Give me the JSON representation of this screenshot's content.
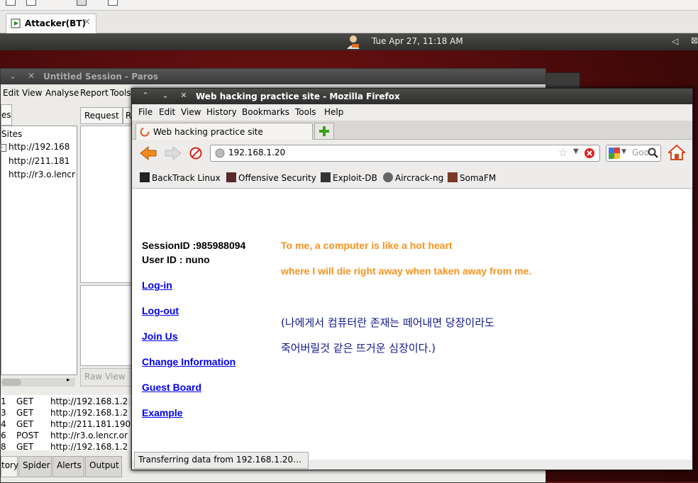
{
  "vm": {
    "tab_label": "Attacker(BT)"
  },
  "panel": {
    "clock": "Tue Apr 27, 11:18 AM"
  },
  "paros": {
    "title": "Untitled Session - Paros",
    "menu": [
      "Edit",
      "View",
      "Analyse",
      "Report",
      "Tools"
    ],
    "sites_tab": "es",
    "sites_root": "Sites",
    "sites": [
      "http://192.168",
      "http://211.181",
      "http://r3.o.lencr"
    ],
    "request_tab": "Request",
    "request_tab2": "R",
    "raw_view": "Raw View",
    "history": [
      {
        "id": "1",
        "method": "GET",
        "url": "http://192.168.1.2"
      },
      {
        "id": "3",
        "method": "GET",
        "url": "http://192.168.1.2"
      },
      {
        "id": "4",
        "method": "GET",
        "url": "http://211.181.190"
      },
      {
        "id": "6",
        "method": "POST",
        "url": "http://r3.o.lencr.or"
      },
      {
        "id": "8",
        "method": "GET",
        "url": "http://192.168.1.2"
      }
    ],
    "bottom_tabs": [
      "tory",
      "Spider",
      "Alerts",
      "Output"
    ]
  },
  "firefox": {
    "title": "Web hacking practice site - Mozilla Firefox",
    "menu": [
      "File",
      "Edit",
      "View",
      "History",
      "Bookmarks",
      "Tools",
      "Help"
    ],
    "tab_label": "Web hacking practice site",
    "url": "192.168.1.20",
    "search_placeholder": "Goo",
    "bookmarks": [
      "BackTrack Linux",
      "Offensive Security",
      "Exploit-DB",
      "Aircrack-ng",
      "SomaFM"
    ],
    "status": "Transferring data from 192.168.1.20…"
  },
  "page": {
    "session_id": "SessionID :985988094",
    "user_id": "User ID : nuno",
    "links": [
      "Log-in",
      "Log-out",
      "Join Us",
      "Change Information",
      "Guest Board",
      "Example"
    ],
    "english_line1": "To me, a computer is like a hot heart",
    "english_line2": "where I will die right away when taken away from me.",
    "korean_line1": "(나에게서 컴퓨터란 존재는 떼어내면 당장이라도",
    "korean_line2": "죽어버릴것 같은 뜨거운 심장이다.)"
  }
}
